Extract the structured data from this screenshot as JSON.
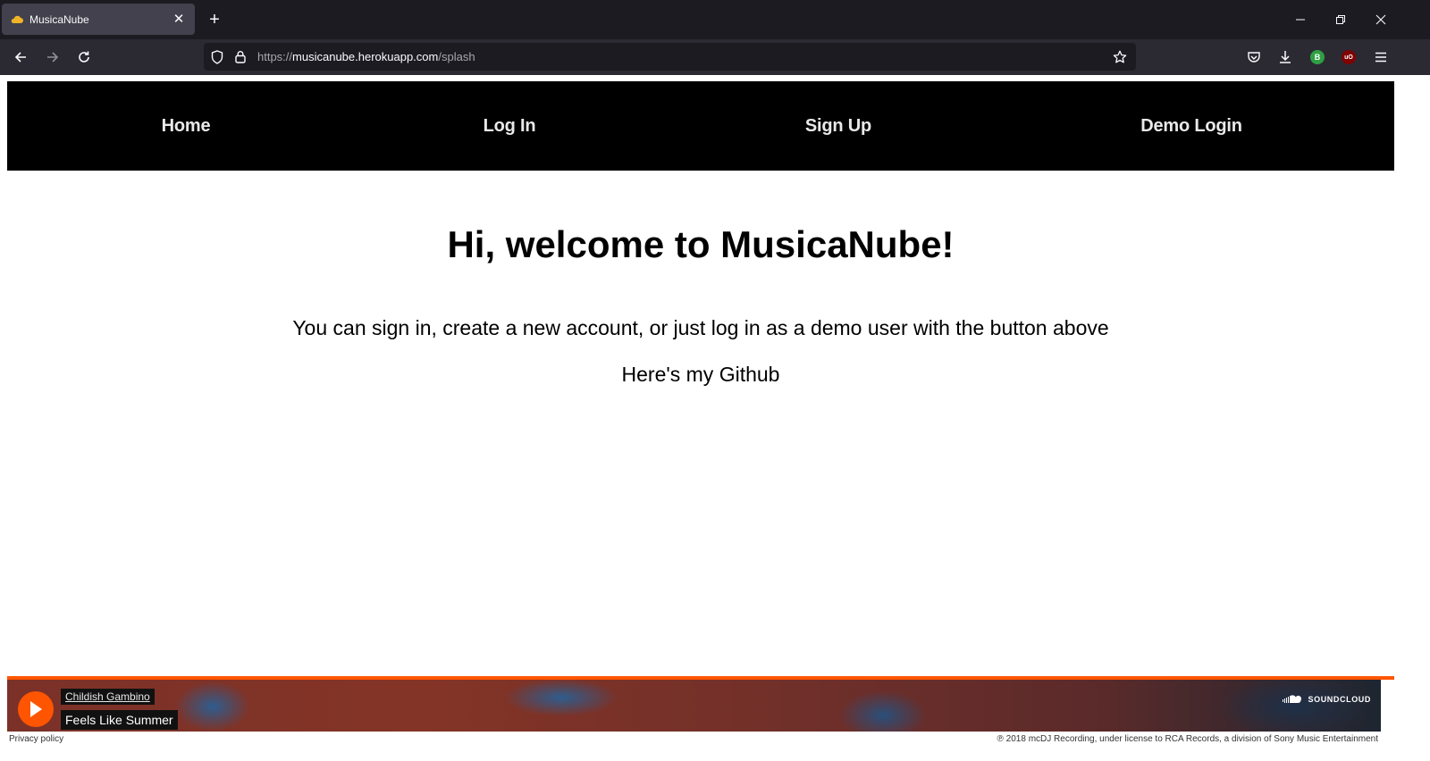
{
  "browser": {
    "tab": {
      "title": "MusicaNube",
      "favicon": "cloud-icon"
    },
    "url": {
      "scheme": "https://",
      "host": "musicanube.herokuapp.com",
      "path": "/splash"
    },
    "extensions": [
      {
        "name": "B",
        "color": "#2ea043"
      },
      {
        "name": "uO",
        "color": "#800000"
      }
    ]
  },
  "site": {
    "nav": [
      {
        "label": "Home"
      },
      {
        "label": "Log In"
      },
      {
        "label": "Sign Up"
      },
      {
        "label": "Demo Login"
      }
    ],
    "welcome": "Hi, welcome to MusicaNube!",
    "intro": "You can sign in, create a new account, or just log in as a demo user with the button above",
    "github": "Here's my Github"
  },
  "player": {
    "artist": "Childish Gambino",
    "track": "Feels Like Summer",
    "logo_text": "SOUNDCLOUD",
    "privacy": "Privacy policy",
    "copyright": "℗ 2018 mcDJ Recording, under license to RCA Records, a division of Sony Music Entertainment",
    "accent": "#ff5500"
  }
}
